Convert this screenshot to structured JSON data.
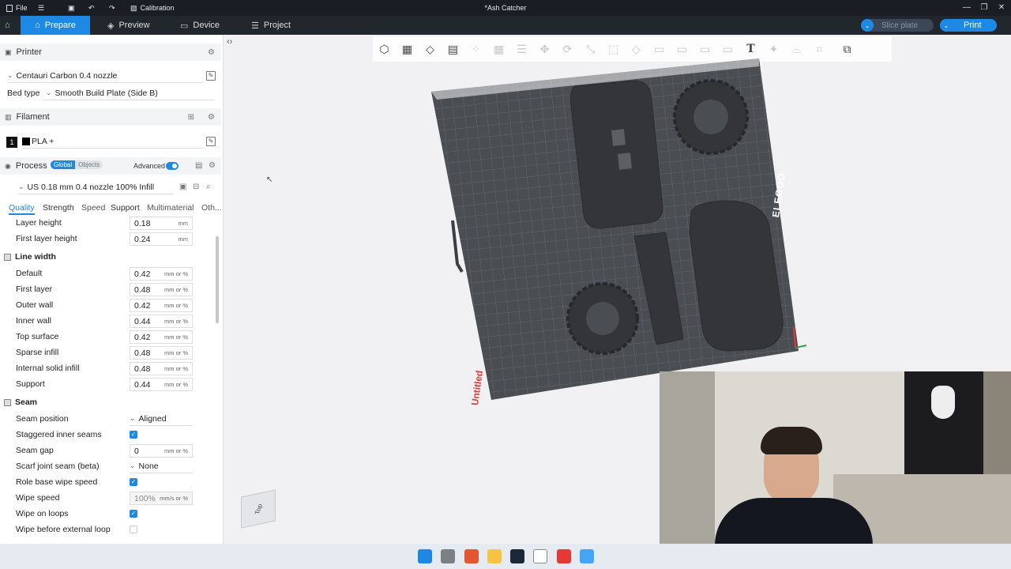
{
  "titlebar": {
    "file_label": "File",
    "calibration_label": "Calibration",
    "window_title": "*Ash Catcher"
  },
  "tabs": {
    "prepare": "Prepare",
    "preview": "Preview",
    "device": "Device",
    "project": "Project"
  },
  "actions": {
    "slice_label": "Slice plate",
    "print_label": "Print"
  },
  "printer": {
    "section_title": "Printer",
    "name": "Centauri Carbon 0.4 nozzle",
    "bed_type_label": "Bed type",
    "bed_type_value": "Smooth Build Plate (Side B)"
  },
  "filament": {
    "section_title": "Filament",
    "slot": "1",
    "name": "PLA +"
  },
  "process": {
    "section_title": "Process",
    "global_label": "Global",
    "objects_label": "Objects",
    "advanced_label": "Advanced",
    "preset": "US 0.18 mm 0.4 nozzle 100% Infill",
    "subtabs": [
      "Quality",
      "Strength",
      "Speed",
      "Support",
      "Multimaterial",
      "Oth..."
    ]
  },
  "quality": {
    "layer_height": {
      "label": "Layer height",
      "value": "0.18",
      "unit": "mm"
    },
    "first_layer_height": {
      "label": "First layer height",
      "value": "0.24",
      "unit": "mm"
    },
    "line_width_title": "Line width",
    "line_width": [
      {
        "label": "Default",
        "value": "0.42",
        "unit": "mm or %"
      },
      {
        "label": "First layer",
        "value": "0.48",
        "unit": "mm or %"
      },
      {
        "label": "Outer wall",
        "value": "0.42",
        "unit": "mm or %"
      },
      {
        "label": "Inner wall",
        "value": "0.44",
        "unit": "mm or %"
      },
      {
        "label": "Top surface",
        "value": "0.42",
        "unit": "mm or %"
      },
      {
        "label": "Sparse infill",
        "value": "0.48",
        "unit": "mm or %"
      },
      {
        "label": "Internal solid infill",
        "value": "0.48",
        "unit": "mm or %"
      },
      {
        "label": "Support",
        "value": "0.44",
        "unit": "mm or %"
      }
    ],
    "seam_title": "Seam",
    "seam_position": {
      "label": "Seam position",
      "value": "Aligned"
    },
    "staggered_inner_seams": {
      "label": "Staggered inner seams"
    },
    "seam_gap": {
      "label": "Seam gap",
      "value": "0",
      "unit": "mm or %"
    },
    "scarf_joint_seam": {
      "label": "Scarf joint seam (beta)",
      "value": "None"
    },
    "role_base_wipe_speed": {
      "label": "Role base wipe speed"
    },
    "wipe_speed": {
      "label": "Wipe speed",
      "value": "100%",
      "unit": "mm/s or %"
    },
    "wipe_on_loops": {
      "label": "Wipe on loops"
    },
    "wipe_before_external_loop": {
      "label": "Wipe before external loop"
    }
  },
  "plate": {
    "brand": "ELEGOO",
    "plate_name": "Untitled",
    "view_cube_label": "Top"
  },
  "colors": {
    "accent": "#1e88e5",
    "titlebar": "#1a1e24",
    "tabbar": "#22262d",
    "plate": "#4a4d52",
    "part": "#333538"
  }
}
